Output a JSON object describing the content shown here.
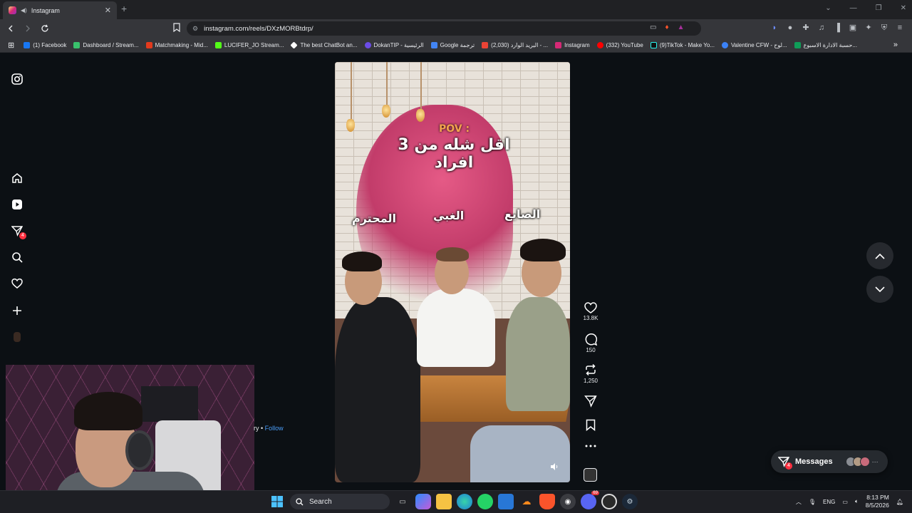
{
  "browser": {
    "tab_title": "Instagram",
    "url": "instagram.com/reels/DXzMORBtdrp/",
    "bookmarks": [
      {
        "label": "(1) Facebook",
        "color": "#1877f2"
      },
      {
        "label": "Dashboard / Stream...",
        "color": "#39c16c"
      },
      {
        "label": "Matchmaking - Mid...",
        "color": "#e23a1d"
      },
      {
        "label": "LUCIFER_JO Stream...",
        "color": "#53fc18"
      },
      {
        "label": "The best ChatBot an...",
        "color": "#ffffff"
      },
      {
        "label": "DokanTIP - الرئيسية",
        "color": "#6b4ce6"
      },
      {
        "label": "Google ترجمة",
        "color": "#4285f4"
      },
      {
        "label": "البريد الوارد (2,030) - ...",
        "color": "#ea4335"
      },
      {
        "label": "Instagram",
        "color": "#d62976"
      },
      {
        "label": "(332) YouTube",
        "color": "#ff0000"
      },
      {
        "label": "(9)TikTok - Make Yo...",
        "color": "#111111"
      },
      {
        "label": "Valentine CFW - لوح...",
        "color": "#3b82f6"
      },
      {
        "label": "حسبة الادارة الاسبوع...",
        "color": "#0f9d58"
      }
    ]
  },
  "sidebar": {
    "notifications_badge": "4"
  },
  "reel": {
    "pov": "POV :",
    "caption": "اقل شله من 3 افراد",
    "labels": {
      "left": "المحترم",
      "middle": "الغبي",
      "right": "الصايع"
    }
  },
  "actions": {
    "likes": "13.8K",
    "comments": "150",
    "reposts": "1,250"
  },
  "overlay": {
    "user_fragment": "ry •",
    "follow": "Follow"
  },
  "messages": {
    "label": "Messages",
    "badge": "4",
    "avatar_colors": [
      "#8a8d93",
      "#b39b84",
      "#c86a7a"
    ]
  },
  "taskbar": {
    "search_label": "Search",
    "language": "ENG",
    "time": "8:13 PM",
    "date": "8/5/2026",
    "discord_badge": "69"
  },
  "colors": {
    "accent": "#4a9df8",
    "badge": "#ff3040"
  }
}
